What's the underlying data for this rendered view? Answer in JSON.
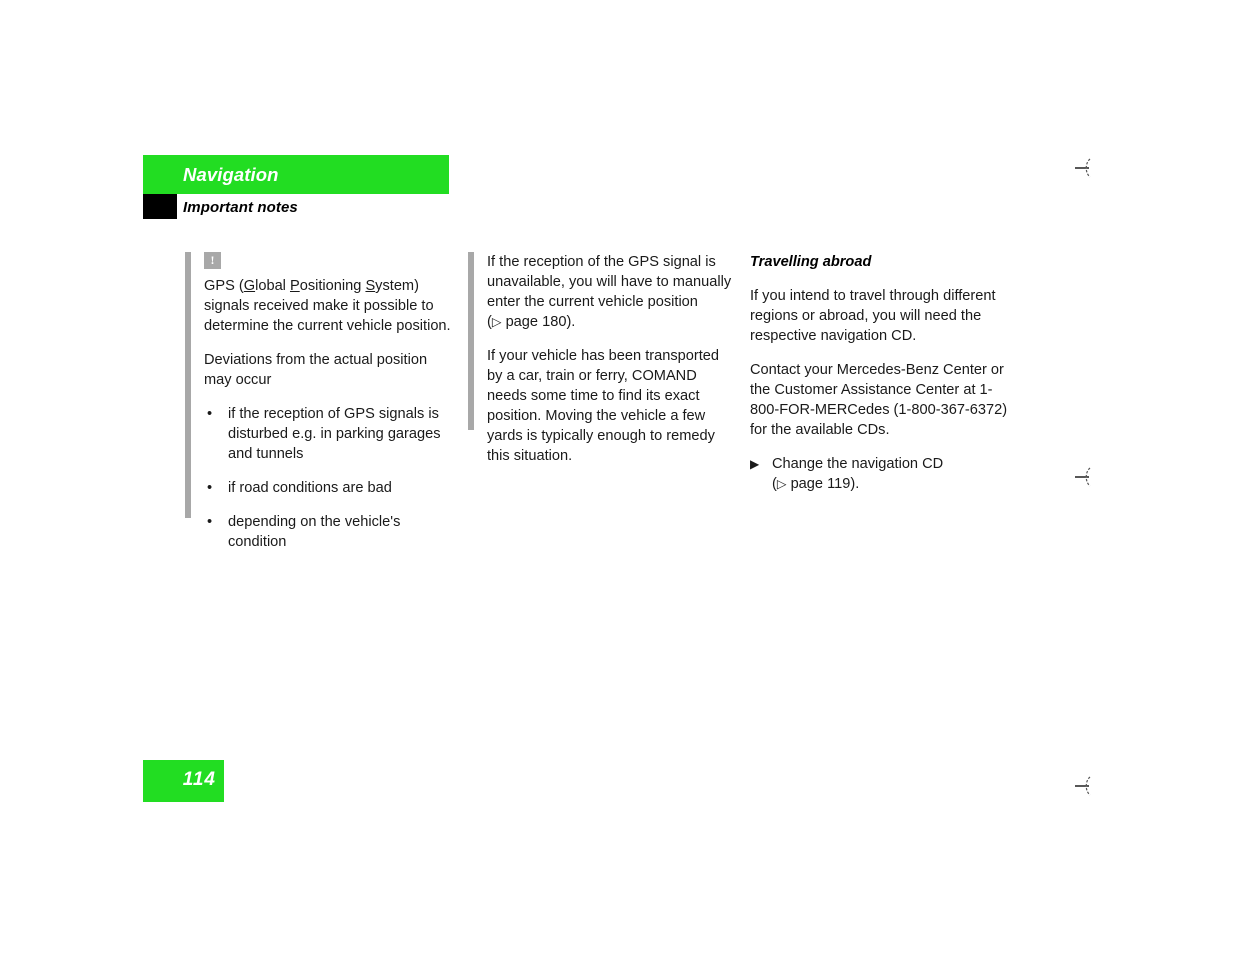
{
  "header": {
    "chapter": "Navigation",
    "section": "Important notes",
    "chapter_bar_color": "#22dd22",
    "section_marker_color": "#000000"
  },
  "columns": {
    "column_1": {
      "icon": "warning-exclamation-icon",
      "icon_label": "!",
      "paragraphs": [
        {
          "id": "gps-definition",
          "runs": [
            {
              "text": "GPS ("
            },
            {
              "text": "G",
              "underline": true
            },
            {
              "text": "lobal "
            },
            {
              "text": "P",
              "underline": true
            },
            {
              "text": "ositioning "
            },
            {
              "text": "S",
              "underline": true
            },
            {
              "text": "ystem) signals received make it possible to determine the current vehicle position."
            }
          ]
        },
        {
          "id": "deviations",
          "runs": [
            {
              "text": "Deviations from the actual position may occur"
            }
          ]
        }
      ],
      "bullets": [
        "if the reception of GPS signals is disturbed e.g. in parking garages and tunnels",
        "if road conditions are bad",
        "depending on the vehicle's condition"
      ],
      "bullet_glyph": "•"
    },
    "column_2": {
      "paragraphs": [
        {
          "id": "manual-entry",
          "text": "If the reception of the GPS signal is unavailable, you will have to manually enter the current vehicle position",
          "reference": {
            "arrow": "▷",
            "label": "page 180",
            "suffix": ").",
            "prefix": "("
          }
        },
        {
          "id": "transported-vehicle",
          "text": "If your vehicle has been transported by a car, train or ferry, COMAND needs some time to find its exact position. Moving the vehicle a few yards is typically enough to remedy this situation."
        }
      ]
    },
    "column_3": {
      "subhead": "Travelling abroad",
      "paragraphs": [
        {
          "id": "different-regions",
          "text": "If you intend to travel through different regions or abroad, you will need the respective navigation CD."
        },
        {
          "id": "contact-info",
          "text": "Contact your Mercedes-Benz Center or the Customer Assistance Center at 1-800-FOR-MERCedes (1-800-367-6372) for the available CDs."
        }
      ],
      "actions": [
        {
          "glyph": "▶",
          "text": "Change the navigation CD",
          "reference": {
            "prefix": "(",
            "arrow": "▷",
            "label": "page 119",
            "suffix": ")."
          }
        }
      ]
    }
  },
  "footer": {
    "page_number": "114",
    "page_box_color": "#22dd22"
  },
  "marks": {
    "name": "cut-mark",
    "count": 3
  }
}
